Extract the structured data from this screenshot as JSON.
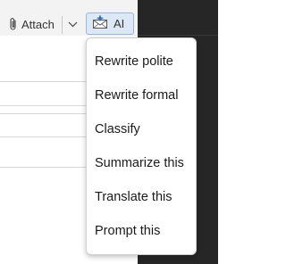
{
  "toolbar": {
    "attach_label": "Attach",
    "attach_icon": "paperclip-icon",
    "dropdown_icon": "chevron-down-icon",
    "ai_label": "AI",
    "ai_icon": "envelope-spark-icon"
  },
  "ai_menu": {
    "items": [
      {
        "label": "Rewrite polite"
      },
      {
        "label": "Rewrite formal"
      },
      {
        "label": "Classify"
      },
      {
        "label": "Summarize this"
      },
      {
        "label": "Translate this"
      },
      {
        "label": "Prompt this"
      }
    ]
  },
  "colors": {
    "toolbar_bg": "#f3f3f3",
    "dark_pane": "#262626",
    "ai_button_bg": "#dde8f6",
    "ai_button_border": "#9fb6d3"
  }
}
